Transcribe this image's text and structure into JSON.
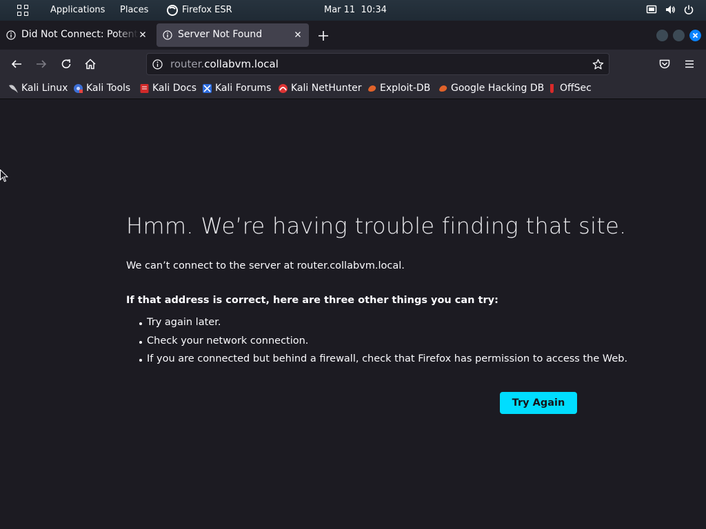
{
  "topbar": {
    "applications": "Applications",
    "places": "Places",
    "app_name": "Firefox ESR",
    "datetime": "Mar 11  10:34",
    "icons": [
      "apps-grid-icon",
      "firefox-icon",
      "display-icon",
      "volume-icon",
      "power-icon"
    ]
  },
  "tabs": [
    {
      "title": "Did Not Connect: Potential Security Issue",
      "active": false,
      "icon": "info-icon"
    },
    {
      "title": "Server Not Found",
      "active": true,
      "icon": "info-icon"
    }
  ],
  "navbar": {
    "url_host_prefix": "router.",
    "url_host_domain": "collabvm.local",
    "icons": [
      "back-icon",
      "forward-icon",
      "reload-icon",
      "home-icon",
      "info-icon",
      "star-icon",
      "pocket-icon",
      "menu-icon"
    ]
  },
  "bookmarks": [
    {
      "label": "Kali Linux",
      "icon": "kali-dragon-icon"
    },
    {
      "label": "Kali Tools",
      "icon": "kali-tools-icon"
    },
    {
      "label": "Kali Docs",
      "icon": "kali-docs-icon"
    },
    {
      "label": "Kali Forums",
      "icon": "kali-forums-icon"
    },
    {
      "label": "Kali NetHunter",
      "icon": "kali-nethunter-icon"
    },
    {
      "label": "Exploit-DB",
      "icon": "exploit-db-icon"
    },
    {
      "label": "Google Hacking DB",
      "icon": "ghdb-icon"
    },
    {
      "label": "OffSec",
      "icon": "offsec-icon"
    }
  ],
  "error": {
    "title": "Hmm. We’re having trouble finding that site.",
    "description": "We can’t connect to the server at router.collabvm.local.",
    "suggest_heading": "If that address is correct, here are three other things you can try:",
    "suggestions": [
      "Try again later.",
      "Check your network connection.",
      "If you are connected but behind a firewall, check that Firefox has permission to access the Web."
    ],
    "button": "Try Again"
  },
  "colors": {
    "page_bg": "#1c1b22",
    "toolbar_bg": "#2b2a33",
    "active_tab": "#42414d",
    "accent_button": "#00ddff",
    "window_close": "#0a84ff"
  }
}
